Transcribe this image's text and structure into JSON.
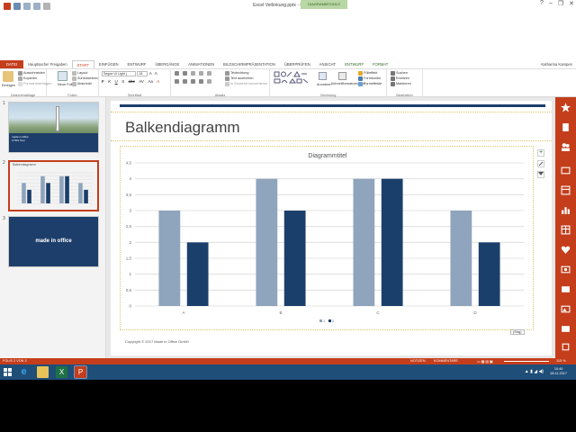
{
  "window": {
    "title": "Excel Verlinkung.pptx - PowerPoint",
    "context_tab_group": "DIAGRAMMTOOLS",
    "user": "Katharina Kampen"
  },
  "tabs": [
    "DATEI",
    "Hauptsache! Freigaben",
    "START",
    "EINFÜGEN",
    "ENTWURF",
    "ÜBERGÄNGE",
    "ANIMATIONEN",
    "BILDSCHIRMPRÄSENTATION",
    "ÜBERPRÜFEN",
    "ANSICHT",
    "ENTWURF",
    "FORMAT"
  ],
  "ribbon": {
    "clipboard": {
      "paste": "Einfügen",
      "cut": "Ausschneiden",
      "copy": "Kopieren",
      "format_painter": "Format übertragen",
      "label": "Zwischenablage"
    },
    "slides": {
      "new_slide": "Neue Folie",
      "layout": "Layout",
      "reset": "Zurücksetzen",
      "section": "Abschnitt",
      "label": "Folien"
    },
    "font": {
      "name": "Segoe UI Light (",
      "size": "18",
      "label": "Schriftart"
    },
    "paragraph": {
      "text_direction": "Textrichtung",
      "align_text": "Text ausrichten",
      "smartart": "In SmartArt konvertieren",
      "label": "Absatz"
    },
    "drawing": {
      "arrange": "Anordnen",
      "quick_styles": "Schnellformatvorlagen",
      "fill": "Fülleffekt",
      "outline": "Formkontur",
      "effects": "Formeffekte",
      "label": "Zeichnung"
    },
    "editing": {
      "find": "Suchen",
      "replace": "Ersetzen",
      "select": "Markieren",
      "label": "Bearbeiten"
    }
  },
  "slides": [
    {
      "number": "1",
      "band_text_1": "made in office",
      "band_text_2": "CTDS Tool"
    },
    {
      "number": "2",
      "title": "Balkendiagramm"
    },
    {
      "number": "3",
      "logo": "made in office"
    }
  ],
  "slide": {
    "title": "Balkendiagramm",
    "footer": "Copyright © 2017 Made in Office GmbH",
    "paste_tag": "(Strg)"
  },
  "chart_data": {
    "type": "bar",
    "title": "Diagrammtitel",
    "categories": [
      "A",
      "B",
      "C",
      "D"
    ],
    "series": [
      {
        "name": "1",
        "values": [
          3,
          4,
          4,
          3
        ],
        "color": "#8fa4bd"
      },
      {
        "name": "2",
        "values": [
          2,
          3,
          4,
          2
        ],
        "color": "#1b3f6b"
      }
    ],
    "yticks": [
      "0",
      "0,5",
      "1",
      "1,5",
      "2",
      "2,5",
      "3",
      "3,5",
      "4",
      "4,5"
    ],
    "ylim": [
      0,
      4.5
    ],
    "grid": true,
    "legend": "bottom"
  },
  "status": {
    "slide": "FOLIE 2 VON 3",
    "notes": "NOTIZEN",
    "comments": "KOMMENTARE",
    "zoom": "115 %"
  },
  "taskbar": {
    "time": "10:40",
    "date": "28.11.2017"
  },
  "colors": {
    "accent": "#c43e1c",
    "navy": "#1d3e6b",
    "taskbar": "#1f4e79"
  }
}
